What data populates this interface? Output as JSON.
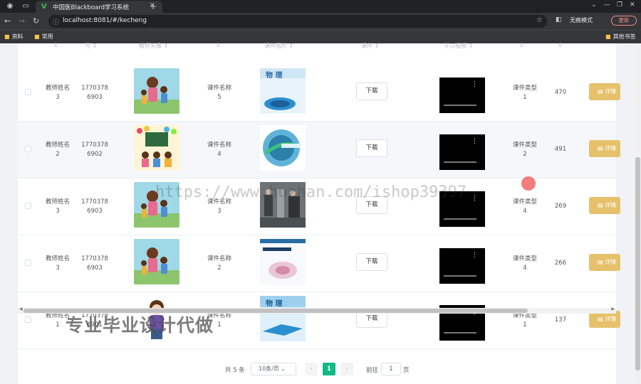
{
  "browser": {
    "tab_title": "中国医Blackboard学习系统",
    "url": "localhost:8081/#/kecheng",
    "incognito_label": "无痕模式",
    "update_label": "更新",
    "bookmarks": [
      "资料",
      "常用"
    ],
    "other_bookmarks": "其他书签"
  },
  "table": {
    "headers": {
      "col1": "号",
      "avatar": "教师头像",
      "cover": "课件图片",
      "file": "课件",
      "video": "学习视频"
    },
    "download_label": "下载",
    "detail_label": "详情",
    "rows": [
      {
        "teacher": "教师姓名\n3",
        "phone": "1770378\n6903",
        "course": "课件名称\n5",
        "type": "课件类型\n1",
        "count": "470"
      },
      {
        "teacher": "教师姓名\n2",
        "phone": "1770378\n6902",
        "course": "课件名称\n4",
        "type": "课件类型\n2",
        "count": "491"
      },
      {
        "teacher": "教师姓名\n3",
        "phone": "1770378\n6903",
        "course": "课件名称\n3",
        "type": "课件类型\n4",
        "count": "269"
      },
      {
        "teacher": "教师姓名\n3",
        "phone": "1770378\n6903",
        "course": "课件名称\n2",
        "type": "课件类型\n4",
        "count": "266"
      },
      {
        "teacher": "教师姓名\n1",
        "phone": "1770378\n6901",
        "course": "课件名称\n1",
        "type": "课件类型\n1",
        "count": "137"
      }
    ]
  },
  "pagination": {
    "total": "共 5 条",
    "page_size": "10条/页",
    "current": "1",
    "goto_label": "前往",
    "goto_value": "1",
    "page_suffix": "页"
  },
  "overlay": {
    "watermark": "https://www.huzhan.com/ishop39397",
    "promo": "专业毕业设计代做"
  },
  "colors": {
    "accent": "#12b886",
    "detail_button": "#e6c16b",
    "chrome_bg": "#202124"
  }
}
